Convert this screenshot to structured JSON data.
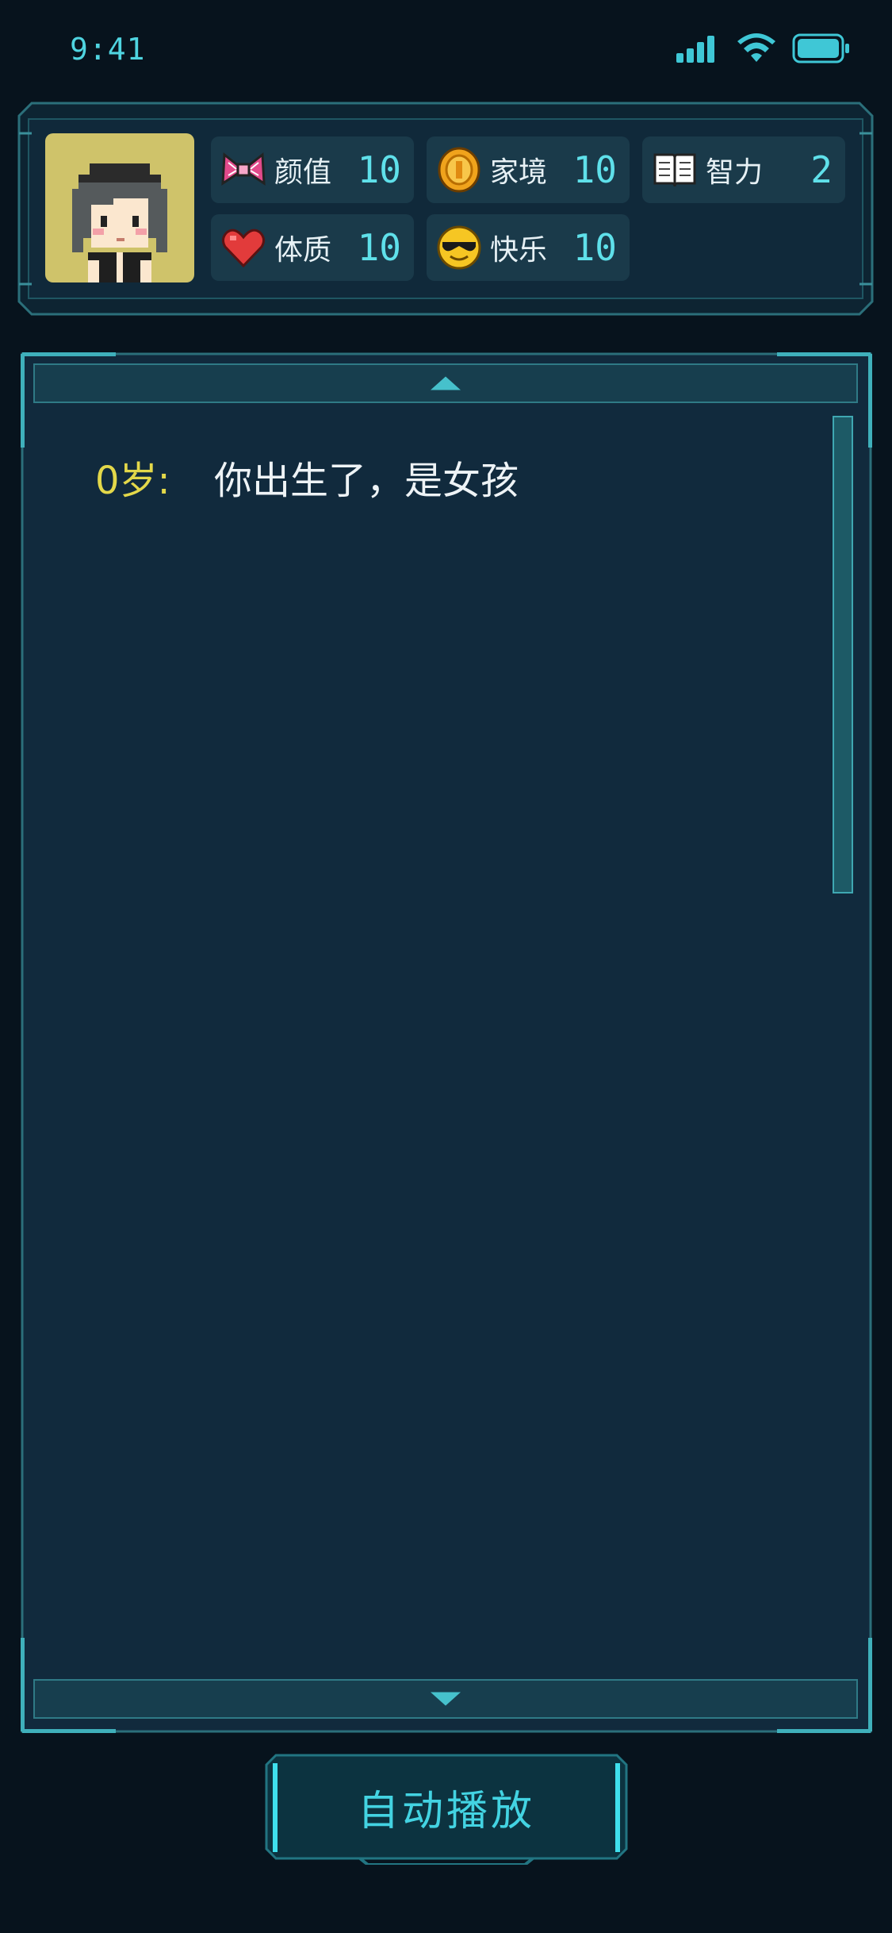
{
  "status_bar": {
    "time": "9:41",
    "icons": [
      "signal-icon",
      "wifi-icon",
      "battery-icon"
    ]
  },
  "stats": [
    {
      "icon": "bow-icon",
      "label": "颜值",
      "value": "10"
    },
    {
      "icon": "coin-icon",
      "label": "家境",
      "value": "10"
    },
    {
      "icon": "book-icon",
      "label": "智力",
      "value": "2"
    },
    {
      "icon": "heart-icon",
      "label": "体质",
      "value": "10"
    },
    {
      "icon": "cool-face-icon",
      "label": "快乐",
      "value": "10"
    }
  ],
  "avatar": {
    "icon": "pixel-girl-avatar",
    "background": "#cfc36a"
  },
  "log": [
    {
      "age": "0岁:",
      "text": "你出生了，是女孩"
    }
  ],
  "auto_play": {
    "label": "自动播放"
  },
  "colors": {
    "accent": "#43d3e2",
    "panel": "#12293b",
    "age_text": "#e3d84a"
  }
}
